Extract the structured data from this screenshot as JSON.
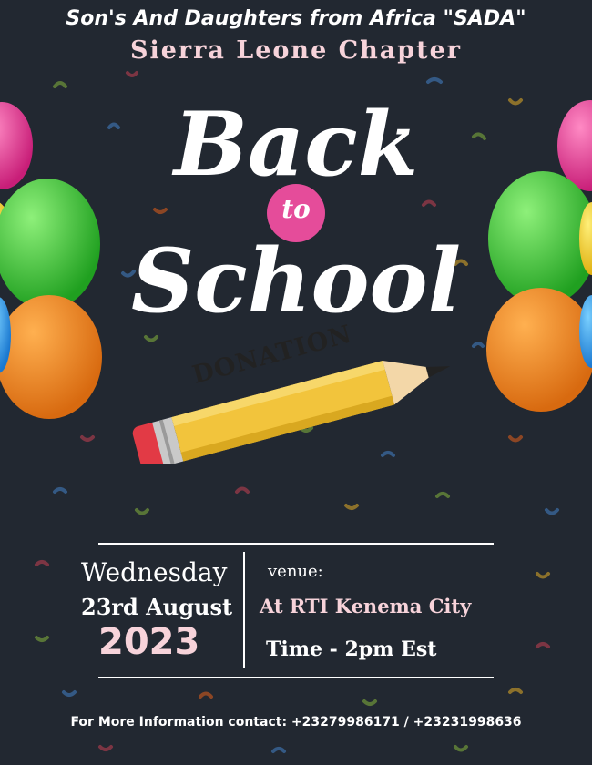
{
  "header": {
    "organization": "Son's And Daughters from Africa \"SADA\"",
    "chapter": "Sierra Leone Chapter"
  },
  "title": {
    "line1": "Back",
    "connector": "to",
    "line2": "School",
    "badge": "DONATION"
  },
  "event": {
    "day": "Wednesday",
    "date": "23rd August",
    "year": "2023",
    "venue_label": "venue:",
    "venue": "At RTI Kenema City",
    "time": "Time - 2pm Est"
  },
  "footer": {
    "contact": "For More Information contact: +23279986171 / +23231998636"
  },
  "colors": {
    "background": "#222831",
    "accent_pink": "#e54c9a",
    "soft_pink": "#f7d3da",
    "pencil_yellow": "#f2c43c"
  },
  "icons": [
    "balloon-cluster-left",
    "balloon-cluster-right",
    "pencil-icon",
    "confetti-pattern"
  ]
}
